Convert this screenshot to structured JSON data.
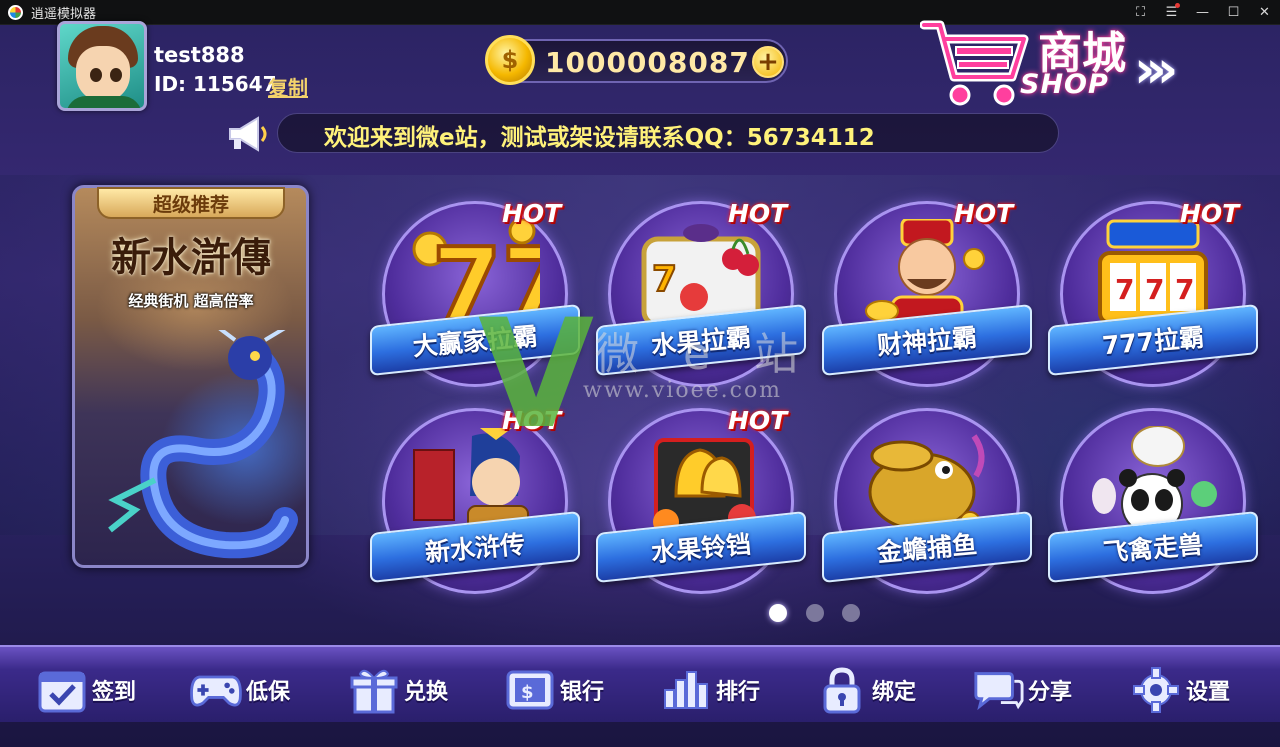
{
  "window": {
    "title": "逍遥模拟器",
    "controls": [
      "fullscreen-icon",
      "menu-icon",
      "minimize-icon",
      "maximize-icon",
      "close-icon"
    ]
  },
  "user": {
    "name": "test888",
    "id_text": "ID: 115647",
    "copy_label": "复制"
  },
  "coins": {
    "amount": "1000008087",
    "add_symbol": "+"
  },
  "shop": {
    "label_cn": "商城",
    "label_en": "SHOP"
  },
  "marquee": {
    "text": "欢迎来到微e站，测试或架设请联系QQ：56734112"
  },
  "featured": {
    "badge": "超级推荐",
    "title": "新水滸傳",
    "subtitle": "经典街机 超高倍率"
  },
  "games": [
    {
      "label": "大赢家拉霸",
      "hot": "HOT"
    },
    {
      "label": "水果拉霸",
      "hot": "HOT"
    },
    {
      "label": "财神拉霸",
      "hot": "HOT"
    },
    {
      "label": "777拉霸",
      "hot": "HOT"
    },
    {
      "label": "新水浒传",
      "hot": "HOT"
    },
    {
      "label": "水果铃铛",
      "hot": "HOT"
    },
    {
      "label": "金蟾捕鱼",
      "hot": ""
    },
    {
      "label": "飞禽走兽",
      "hot": ""
    }
  ],
  "watermark": {
    "letter": "V",
    "text": "微e站",
    "url": "www.vioee.com"
  },
  "pager": {
    "pages": 3,
    "active": 0
  },
  "bottom_nav": [
    {
      "label": "签到",
      "icon": "calendar-check-icon"
    },
    {
      "label": "低保",
      "icon": "gamepad-icon"
    },
    {
      "label": "兑换",
      "icon": "gift-icon"
    },
    {
      "label": "银行",
      "icon": "bank-card-icon"
    },
    {
      "label": "排行",
      "icon": "ranking-icon"
    },
    {
      "label": "绑定",
      "icon": "lock-icon"
    },
    {
      "label": "分享",
      "icon": "chat-icon"
    },
    {
      "label": "设置",
      "icon": "gear-icon"
    }
  ],
  "colors": {
    "accent_gold": "#f4d36b",
    "marquee_text": "#fff27a",
    "ribbon_blue": "#2d6fe0",
    "hot_red": "#ff2a2a"
  }
}
